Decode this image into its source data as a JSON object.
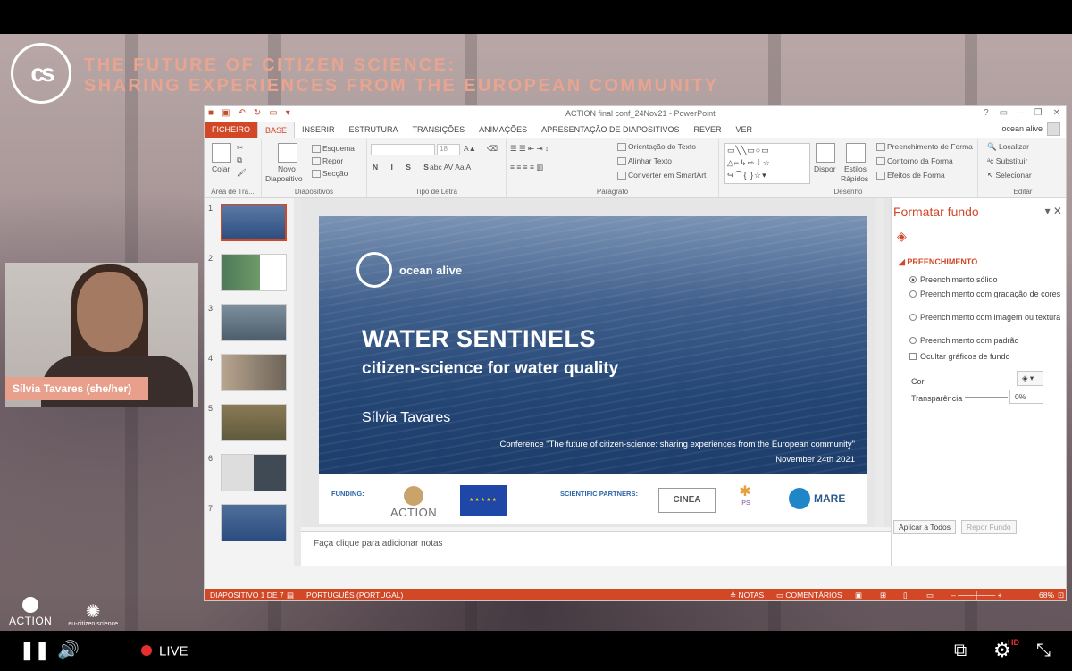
{
  "conference": {
    "logo_text": "cs",
    "title_line1": "THE FUTURE OF CITIZEN SCIENCE:",
    "title_line2": "SHARING EXPERIENCES FROM THE EUROPEAN COMMUNITY"
  },
  "ppt": {
    "window_title": "ACTION final conf_24Nov21 - PowerPoint",
    "user": "ocean alive",
    "tabs": [
      "FICHEIRO",
      "BASE",
      "INSERIR",
      "ESTRUTURA",
      "TRANSIÇÕES",
      "ANIMAÇÕES",
      "APRESENTAÇÃO DE DIAPOSITIVOS",
      "REVER",
      "VER"
    ],
    "active_tab": "BASE",
    "ribbon": {
      "colar": "Colar",
      "area_label": "Área de Tra...",
      "novo": "Novo",
      "diapositivo": "Diapositivo",
      "esquema": "Esquema",
      "repor": "Repor",
      "seccao": "Secção",
      "diapositivos_label": "Diapositivos",
      "font_size": "18",
      "tipo_label": "Tipo de Letra",
      "orientacao": "Orientação do Texto",
      "alinhar": "Alinhar Texto",
      "converter": "Converter em SmartArt",
      "paragrafo_label": "Parágrafo",
      "dispor": "Dispor",
      "estilos": "Estilos",
      "rapidos": "Rápidos",
      "preenchimento_forma": "Preenchimento de Forma",
      "contorno_forma": "Contorno da Forma",
      "efeitos_forma": "Efeitos de Forma",
      "desenho_label": "Desenho",
      "localizar": "Localizar",
      "substituir": "Substituir",
      "selecionar": "Selecionar",
      "editar_label": "Editar"
    },
    "thumbnails": [
      "1",
      "2",
      "3",
      "4",
      "5",
      "6",
      "7"
    ],
    "slide": {
      "brand": "ocean alive",
      "title": "WATER SENTINELS",
      "subtitle": "citizen-science for water quality",
      "author": "Sílvia Tavares",
      "conference_line": "Conference \"The future of citizen-science: sharing experiences from the European community\"",
      "date": "November 24th 2021",
      "funding_label": "FUNDING:",
      "action_logo": "ACTION",
      "partners_label": "SCIENTIFIC PARTNERS:",
      "cinea": "CINEA",
      "ips": "IPS",
      "mare": "MARE"
    },
    "notes_placeholder": "Faça clique para adicionar notas",
    "format_pane": {
      "title": "Formatar fundo",
      "section": "PREENCHIMENTO",
      "options": [
        "Preenchimento sólido",
        "Preenchimento com gradação de cores",
        "Preenchimento com imagem ou textura",
        "Preenchimento com padrão"
      ],
      "hide_graphics": "Ocultar gráficos de fundo",
      "cor_label": "Cor",
      "transparencia_label": "Transparência",
      "transparencia_value": "0%",
      "apply_all": "Aplicar a Todos",
      "reset": "Repor Fundo"
    },
    "status": {
      "slide_info": "DIAPOSITIVO 1 DE 7",
      "language": "PORTUGUÊS (PORTUGAL)",
      "notes": "NOTAS",
      "comments": "COMENTÁRIOS",
      "zoom": "68%"
    }
  },
  "speaker": {
    "name": "Sílvia Tavares (she/her)"
  },
  "footer_logos": {
    "action": "ACTION",
    "eu_cs": "eu-citizen.science"
  },
  "player": {
    "live": "LIVE",
    "hd": "HD"
  }
}
